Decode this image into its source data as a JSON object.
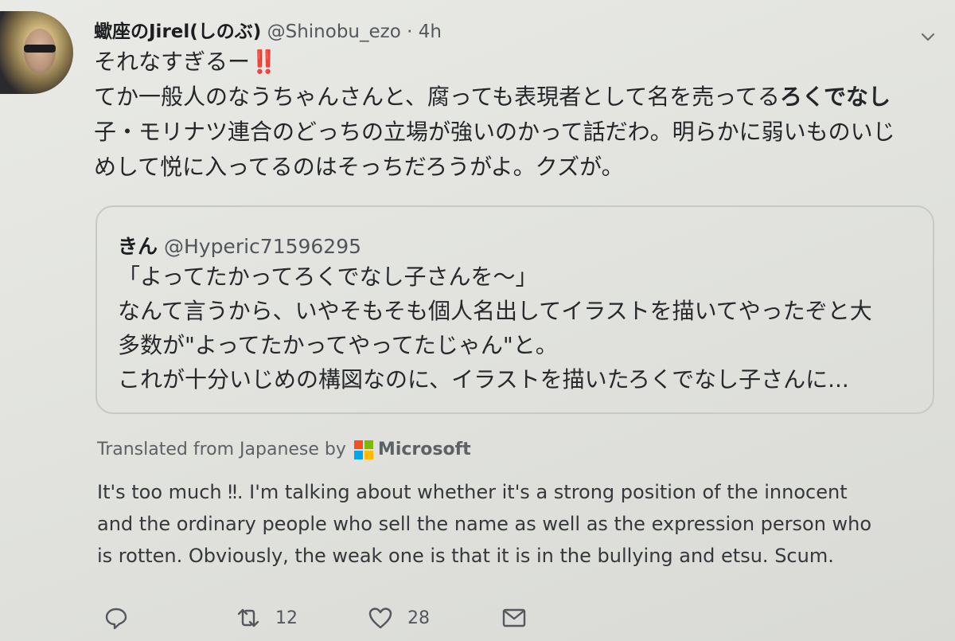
{
  "tweet": {
    "display_name": "蠍座のJirel(しのぶ)",
    "handle": "@Shinobu_ezo",
    "separator": "·",
    "time": "4h",
    "body_lines": [
      {
        "text": "それなすぎるー",
        "bang": "‼️"
      },
      {
        "text": "てか一般人のなうちゃんさんと、腐っても表現者として名を売ってる",
        "bold": "ろくでなし"
      },
      {
        "text": "子・モリナツ連合のどっちの立場が強いのかって話だわ。明らかに弱いものいじ"
      },
      {
        "text": "めして悦に入ってるのはそっちだろうがよ。クズが。"
      }
    ]
  },
  "quoted_tweet": {
    "display_name": "きん",
    "handle": "@Hyperic71596295",
    "body_lines": [
      "「よってたかってろくでなし子さんを〜」",
      "なんて言うから、いやそもそも個人名出してイラストを描いてやったぞと大",
      "多数が\"よってたかってやってたじゃん\"と。",
      "これが十分いじめの構図なのに、イラストを描いたろくでなし子さんに..."
    ]
  },
  "translation": {
    "label": "Translated from Japanese by",
    "provider": "Microsoft",
    "logo_colors": [
      "#f25022",
      "#7fba00",
      "#00a4ef",
      "#ffb900"
    ],
    "lines": [
      "It's too much ‼. I'm talking about whether it's a strong position of the innocent",
      "and the ordinary people who sell the name as well as the expression person who",
      "is rotten. Obviously, the weak one is that it is in the bullying and etsu. Scum."
    ]
  },
  "actions": {
    "reply_icon": "reply-icon",
    "retweet_icon": "retweet-icon",
    "retweet_count": "12",
    "like_icon": "heart-icon",
    "like_count": "28",
    "dm_icon": "envelope-icon"
  },
  "colors": {
    "accent_bang": "#c4262e",
    "icon": "#54585e"
  }
}
